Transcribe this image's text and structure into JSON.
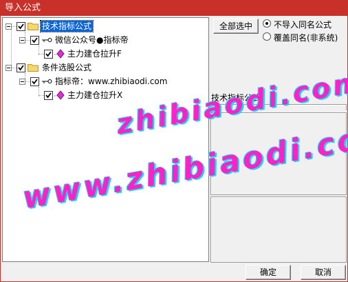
{
  "window": {
    "title": "导入公式"
  },
  "tree": {
    "nodes": [
      {
        "label": "技术指标公式",
        "checked": true,
        "selected": true
      },
      {
        "label": "微信公众号●指标帝",
        "checked": true
      },
      {
        "label": "主力建仓拉升F",
        "checked": true
      },
      {
        "label": "条件选股公式",
        "checked": true
      },
      {
        "label": "指标帝：www.zhibiaodi.com",
        "checked": true
      },
      {
        "label": "主力建仓拉升X",
        "checked": true
      }
    ]
  },
  "options": {
    "select_all_label": "全部选中",
    "radio_skip_label": "不导入同名公式",
    "radio_overwrite_label": "覆盖同名(非系统)",
    "selected_radio": "radio_skip"
  },
  "info": {
    "category_label": "技术指标公式"
  },
  "footer": {
    "ok_label": "确定",
    "cancel_label": "取消"
  },
  "watermark": {
    "line1": "zhibiaodi.com",
    "line2": "www.zhibiaodi.com"
  },
  "colors": {
    "accent": "#c8302a",
    "selection": "#0a64d8",
    "watermark_fill": "#ff21c8",
    "watermark_shadow": "#19d7f0"
  }
}
